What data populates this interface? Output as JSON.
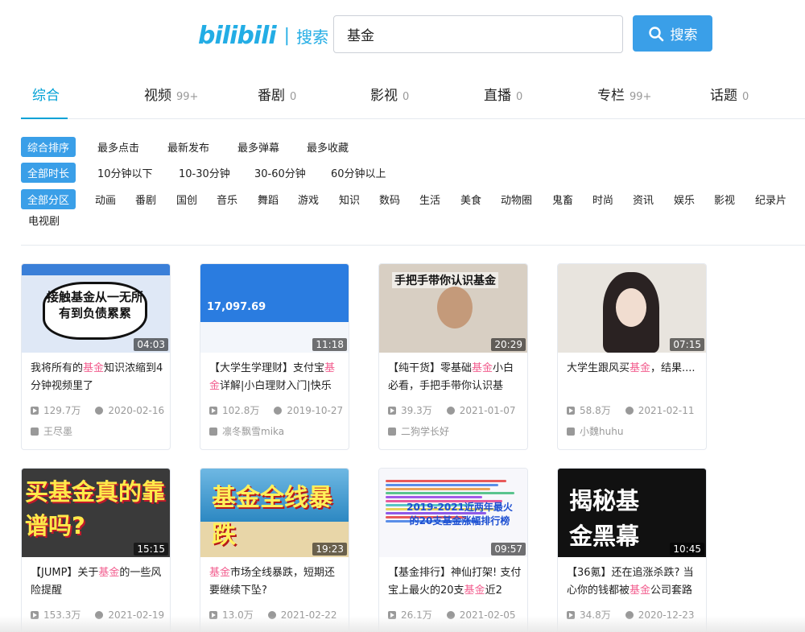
{
  "header": {
    "logo": "bilibili",
    "logo_sub": "搜索",
    "search_value": "基金",
    "search_button": "搜索"
  },
  "tabs": [
    {
      "label": "综合",
      "count": ""
    },
    {
      "label": "视频",
      "count": "99+"
    },
    {
      "label": "番剧",
      "count": "0"
    },
    {
      "label": "影视",
      "count": "0"
    },
    {
      "label": "直播",
      "count": "0"
    },
    {
      "label": "专栏",
      "count": "99+"
    },
    {
      "label": "话题",
      "count": "0"
    }
  ],
  "filters": {
    "sort": [
      "综合排序",
      "最多点击",
      "最新发布",
      "最多弹幕",
      "最多收藏"
    ],
    "duration": [
      "全部时长",
      "10分钟以下",
      "10-30分钟",
      "30-60分钟",
      "60分钟以上"
    ],
    "zone": [
      "全部分区",
      "动画",
      "番剧",
      "国创",
      "音乐",
      "舞蹈",
      "游戏",
      "知识",
      "数码",
      "生活",
      "美食",
      "动物圈",
      "鬼畜",
      "时尚",
      "资讯",
      "娱乐",
      "影视",
      "纪录片",
      "电视剧"
    ]
  },
  "videos": [
    {
      "title_pre": "我将所有的",
      "hl": "基金",
      "title_post": "知识浓缩到4分钟视频里了",
      "duration": "04:03",
      "views": "129.7万",
      "date": "2020-02-16",
      "uploader": "王尽墨",
      "thumb_text": "接触基金从一无所有到负债累累"
    },
    {
      "title_pre": "【大学生学理财】支付宝",
      "hl": "基金",
      "title_post": "详解|小白理财入门|快乐",
      "duration": "11:18",
      "views": "102.8万",
      "date": "2019-10-27",
      "uploader": "凛冬飘雪mika",
      "thumb_text": "17,097.69"
    },
    {
      "title_pre": "【纯干货】零基础",
      "hl": "基金",
      "title_post": "小白必看，手把手带你认识基",
      "duration": "20:29",
      "views": "39.3万",
      "date": "2021-01-07",
      "uploader": "二狗学长好",
      "thumb_text": "手把手带你认识基金"
    },
    {
      "title_pre": "大学生跟风买",
      "hl": "基金",
      "title_post": "，结果....",
      "duration": "07:15",
      "views": "58.8万",
      "date": "2021-02-11",
      "uploader": "小魏huhu",
      "thumb_text": ""
    },
    {
      "title_pre": "【JUMP】关于",
      "hl": "基金",
      "title_post": "的一些风险提醒",
      "duration": "15:15",
      "views": "153.3万",
      "date": "2021-02-19",
      "uploader": "",
      "thumb_text": "买基金真的靠谱吗?"
    },
    {
      "title_pre": "",
      "hl": "基金",
      "title_post": "市场全线暴跌，短期还要继续下坠?",
      "duration": "19:23",
      "views": "13.0万",
      "date": "2021-02-22",
      "uploader": "",
      "thumb_text": "基金全线暴跌"
    },
    {
      "title_pre": "【基金排行】神仙打架! 支付宝上最火的20支",
      "hl": "基金",
      "title_post": "近2",
      "duration": "09:57",
      "views": "26.1万",
      "date": "2021-02-05",
      "uploader": "",
      "thumb_text": "2019-2021近两年最火的20支基金涨幅排行榜"
    },
    {
      "title_pre": "【36氪】还在追涨杀跌? 当心你的钱都被",
      "hl": "基金",
      "title_post": "公司套路",
      "duration": "10:45",
      "views": "34.8万",
      "date": "2020-12-23",
      "uploader": "",
      "thumb_text": "揭秘基金黑幕"
    }
  ],
  "colors": {
    "accent": "#00a1d6",
    "button": "#3a9fe8",
    "highlight": "#f25d8e"
  }
}
